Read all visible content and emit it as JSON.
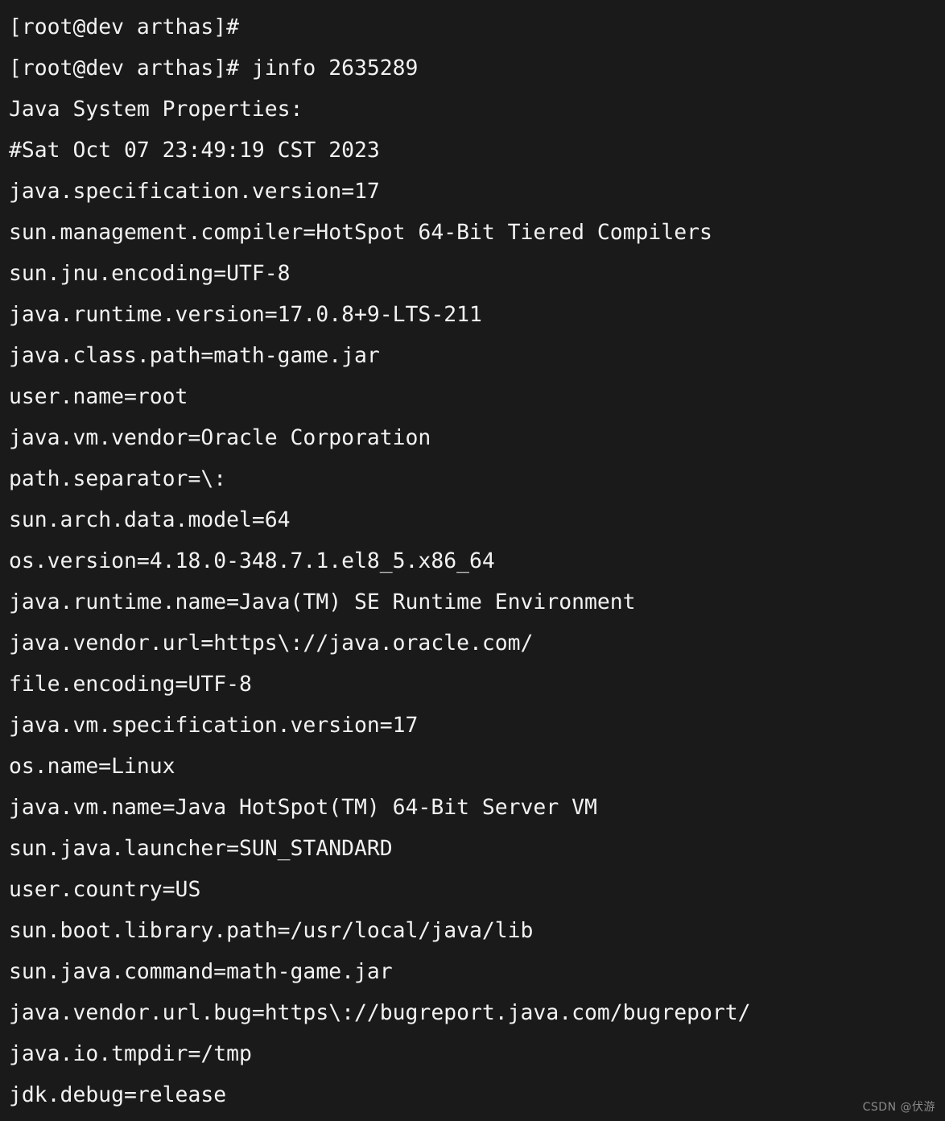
{
  "terminal": {
    "background_color": "#1a1a1a",
    "foreground_color": "#f2f2f2",
    "prompt": "[root@dev arthas]#",
    "command": "jinfo 2635289",
    "lines": [
      "[root@dev arthas]#",
      "[root@dev arthas]# jinfo 2635289",
      "Java System Properties:",
      "#Sat Oct 07 23:49:19 CST 2023",
      "java.specification.version=17",
      "sun.management.compiler=HotSpot 64-Bit Tiered Compilers",
      "sun.jnu.encoding=UTF-8",
      "java.runtime.version=17.0.8+9-LTS-211",
      "java.class.path=math-game.jar",
      "user.name=root",
      "java.vm.vendor=Oracle Corporation",
      "path.separator=\\:",
      "sun.arch.data.model=64",
      "os.version=4.18.0-348.7.1.el8_5.x86_64",
      "java.runtime.name=Java(TM) SE Runtime Environment",
      "java.vendor.url=https\\://java.oracle.com/",
      "file.encoding=UTF-8",
      "java.vm.specification.version=17",
      "os.name=Linux",
      "java.vm.name=Java HotSpot(TM) 64-Bit Server VM",
      "sun.java.launcher=SUN_STANDARD",
      "user.country=US",
      "sun.boot.library.path=/usr/local/java/lib",
      "sun.java.command=math-game.jar",
      "java.vendor.url.bug=https\\://bugreport.java.com/bugreport/",
      "java.io.tmpdir=/tmp",
      "jdk.debug=release"
    ],
    "properties": {
      "java.specification.version": "17",
      "sun.management.compiler": "HotSpot 64-Bit Tiered Compilers",
      "sun.jnu.encoding": "UTF-8",
      "java.runtime.version": "17.0.8+9-LTS-211",
      "java.class.path": "math-game.jar",
      "user.name": "root",
      "java.vm.vendor": "Oracle Corporation",
      "path.separator": "\\:",
      "sun.arch.data.model": "64",
      "os.version": "4.18.0-348.7.1.el8_5.x86_64",
      "java.runtime.name": "Java(TM) SE Runtime Environment",
      "java.vendor.url": "https\\://java.oracle.com/",
      "file.encoding": "UTF-8",
      "java.vm.specification.version": "17",
      "os.name": "Linux",
      "java.vm.name": "Java HotSpot(TM) 64-Bit Server VM",
      "sun.java.launcher": "SUN_STANDARD",
      "user.country": "US",
      "sun.boot.library.path": "/usr/local/java/lib",
      "sun.java.command": "math-game.jar",
      "java.vendor.url.bug": "https\\://bugreport.java.com/bugreport/",
      "java.io.tmpdir": "/tmp",
      "jdk.debug": "release"
    },
    "header": "Java System Properties:",
    "timestamp": "#Sat Oct 07 23:49:19 CST 2023",
    "pid": "2635289"
  },
  "watermark": {
    "text": "CSDN @伏游",
    "color": "#8a8a8a"
  }
}
